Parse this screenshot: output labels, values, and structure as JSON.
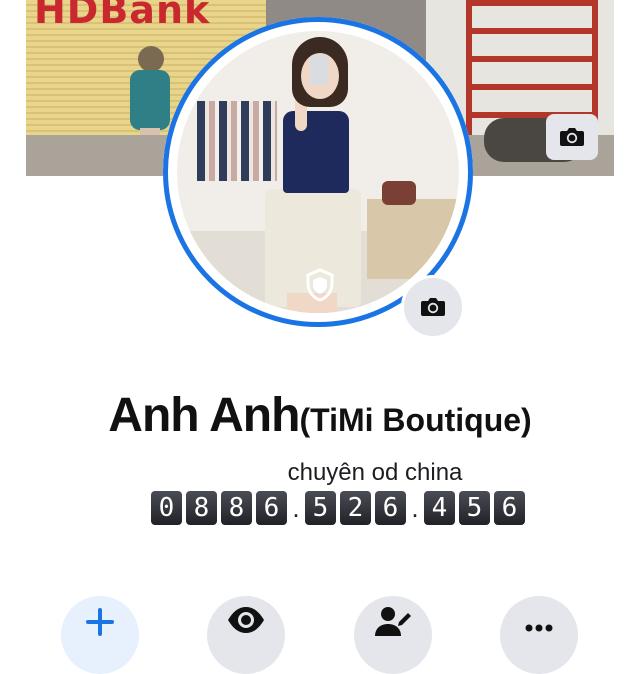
{
  "cover": {
    "sign_text": "HDBank"
  },
  "profile": {
    "name": "Anh Anh",
    "alternate_name": "(TiMi Boutique)",
    "bio": "chuyên od china",
    "phone_digits": [
      "0",
      "8",
      "8",
      "6",
      ".",
      "5",
      "2",
      "6",
      ".",
      "4",
      "5",
      "6"
    ]
  },
  "icons": {
    "cover_camera": "camera-icon",
    "avatar_camera": "camera-icon",
    "profile_guard": "shield-icon",
    "add_story": "plus-icon",
    "view_as": "eye-icon",
    "edit_profile": "edit-profile-icon",
    "more": "more-icon"
  },
  "colors": {
    "accent": "#1b74e4",
    "button_bg": "#e4e6eb",
    "primary_button_bg": "#e7f0fd"
  }
}
